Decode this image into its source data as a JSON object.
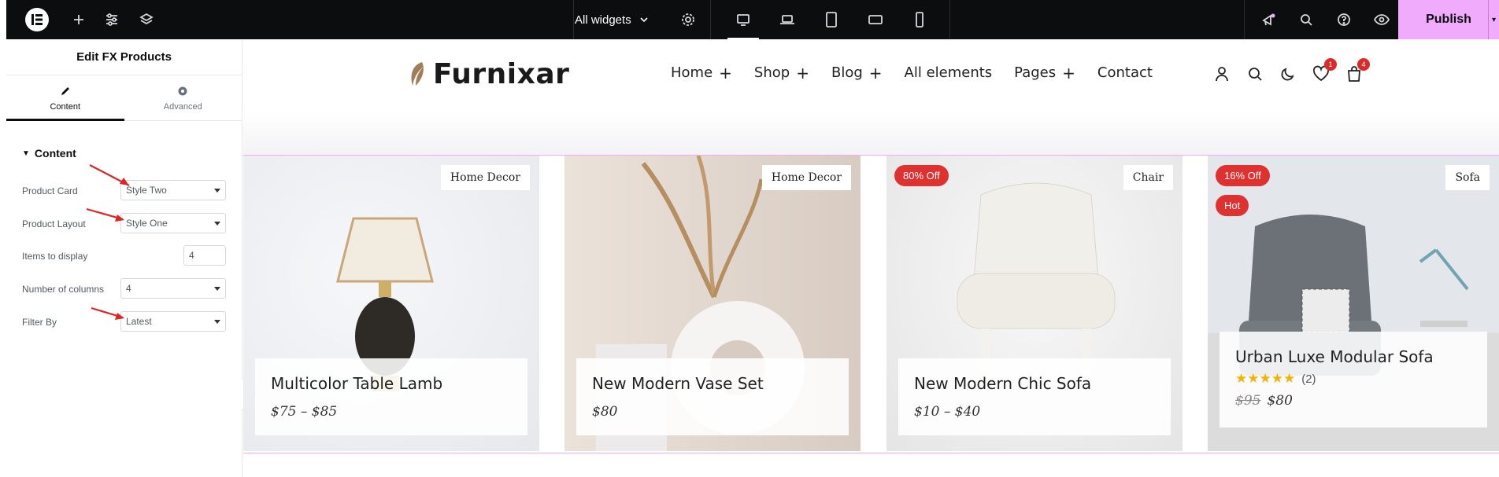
{
  "topbar": {
    "widgets_label": "All widgets",
    "publish_label": "Publish"
  },
  "panel": {
    "title": "Edit FX Products",
    "tabs": [
      {
        "label": "Content"
      },
      {
        "label": "Advanced"
      }
    ],
    "section": "Content",
    "controls": [
      {
        "label": "Product Card",
        "value": "Style Two"
      },
      {
        "label": "Product Layout",
        "value": "Style One"
      },
      {
        "label": "Items to display",
        "value": "4"
      },
      {
        "label": "Number of columns",
        "value": "4"
      },
      {
        "label": "Filter By",
        "value": "Latest"
      }
    ]
  },
  "site": {
    "logo": "Furnixar",
    "nav": [
      {
        "label": "Home",
        "has_sub": true
      },
      {
        "label": "Shop",
        "has_sub": true
      },
      {
        "label": "Blog",
        "has_sub": true
      },
      {
        "label": "All elements",
        "has_sub": false
      },
      {
        "label": "Pages",
        "has_sub": true
      },
      {
        "label": "Contact",
        "has_sub": false
      }
    ],
    "wishlist_count": "1",
    "cart_count": "4"
  },
  "products": [
    {
      "name": "Multicolor Table Lamb",
      "price": "$75  –  $85",
      "category": "Home Decor"
    },
    {
      "name": "New Modern Vase Set",
      "price": "$80",
      "category": "Home Decor"
    },
    {
      "name": "New Modern Chic Sofa",
      "price": "$10  –  $40",
      "category": "Chair",
      "sale": "80% Off"
    },
    {
      "name": "Urban Luxe Modular Sofa",
      "old_price": "$95",
      "price": "$80",
      "category": "Sofa",
      "sale": "16% Off",
      "hot": "Hot",
      "rating_count": "(2)",
      "stars": "★★★★★"
    }
  ],
  "colors": {
    "accent": "#f0abfc",
    "sale": "#e03131",
    "star": "#f5b301"
  }
}
